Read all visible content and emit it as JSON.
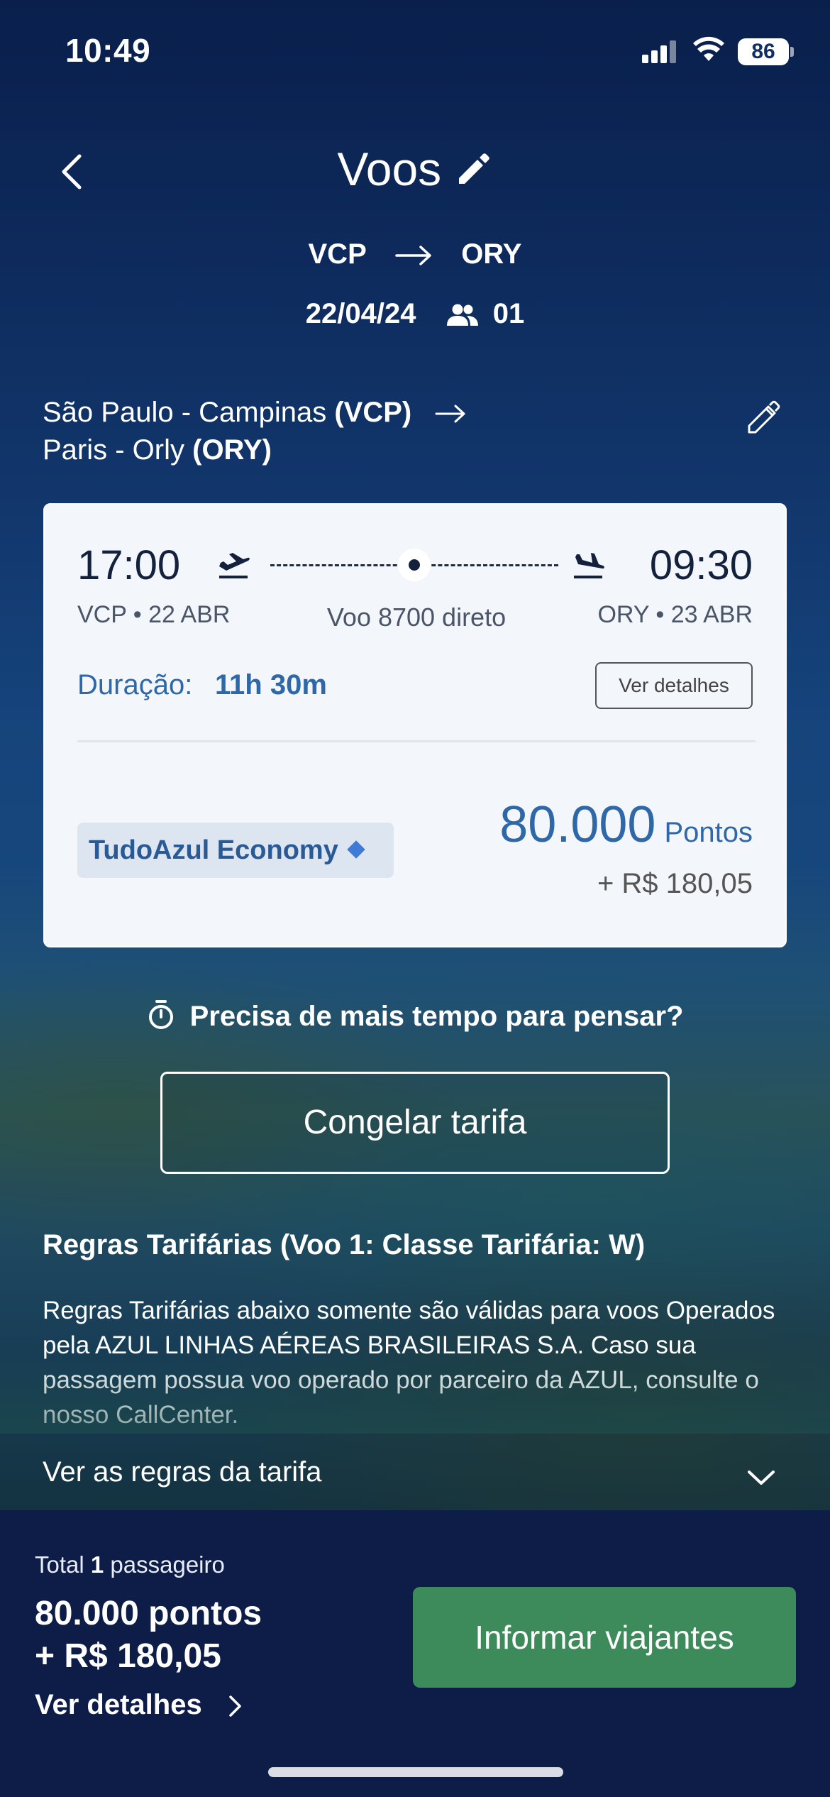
{
  "status_bar": {
    "time": "10:49",
    "battery": "86"
  },
  "header": {
    "title": "Voos",
    "origin": "VCP",
    "destination": "ORY",
    "date": "22/04/24",
    "passengers": "01"
  },
  "route_summary": {
    "origin_city": "São Paulo - Campinas",
    "origin_code": "(VCP)",
    "destination_city": "Paris - Orly",
    "destination_code": "(ORY)"
  },
  "flight_card": {
    "departure_time": "17:00",
    "departure_meta": "VCP • 22 ABR",
    "arrival_time": "09:30",
    "arrival_meta": "ORY • 23 ABR",
    "flight_info": "Voo 8700 direto",
    "duration_label": "Duração:",
    "duration_value": "11h 30m",
    "details_button": "Ver detalhes",
    "fare_class": "TudoAzul Economy",
    "points_value": "80.000",
    "points_unit": "Pontos",
    "cash_value": "+ R$ 180,05"
  },
  "freeze": {
    "question": "Precisa de mais tempo para pensar?",
    "button": "Congelar tarifa"
  },
  "rules": {
    "title": "Regras Tarifárias (Voo 1: Classe Tarifária: W)",
    "body": "Regras Tarifárias abaixo somente são válidas para voos Operados pela AZUL LINHAS AÉREAS BRASILEIRAS S.A. Caso sua passagem possua voo operado por parceiro da AZUL, consulte o nosso CallCenter.",
    "link": "Ver as regras da tarifa"
  },
  "bottom_bar": {
    "total_prefix": "Total",
    "total_count": "1",
    "total_suffix": "passageiro",
    "total_points": "80.000 pontos",
    "total_cash": "+ R$ 180,05",
    "details_link": "Ver detalhes",
    "cta": "Informar viajantes"
  },
  "colors": {
    "accent_blue": "#2f68a8",
    "cta_green": "#3d8a5a",
    "bottom_bar": "#0d1d47"
  },
  "icons": [
    "back-chevron-icon",
    "pencil-icon",
    "arrow-right-icon",
    "passengers-icon",
    "edit-outline-icon",
    "takeoff-icon",
    "landing-icon",
    "timer-icon",
    "chevron-down-icon",
    "chevron-right-icon",
    "wifi-icon",
    "signal-icon"
  ]
}
